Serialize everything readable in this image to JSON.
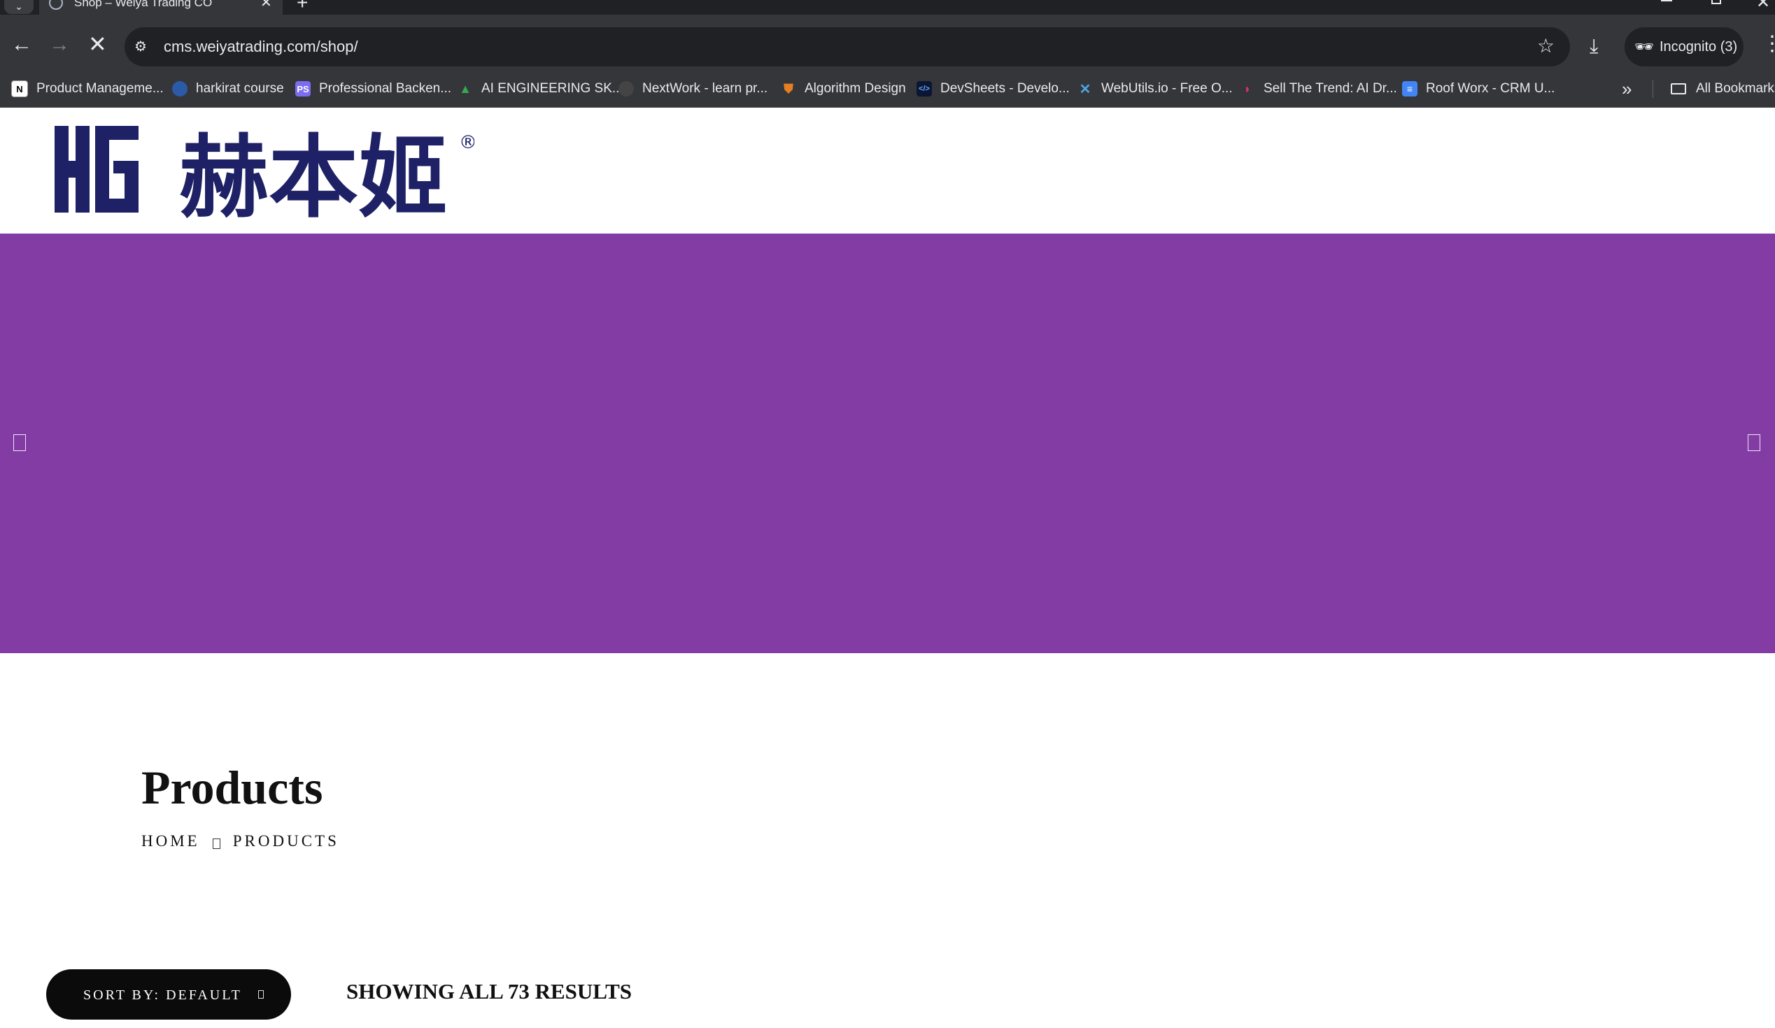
{
  "browser": {
    "tab": {
      "title": "Shop – Weiya Trading CO",
      "close_glyph": "✕"
    },
    "new_tab_glyph": "+",
    "url": "cms.weiyatrading.com/shop/",
    "incognito_label": "Incognito (3)",
    "bookmarks": [
      {
        "label": "Product Manageme...",
        "icon": "notion-icon",
        "color": "#ffffff"
      },
      {
        "label": "harkirat course",
        "icon": "avatar-icon",
        "color": "#2b5aa8"
      },
      {
        "label": "Professional Backen...",
        "icon": "ps-icon",
        "color": "#7b6cf0"
      },
      {
        "label": "AI ENGINEERING SK...",
        "icon": "drive-icon",
        "color": "#34a853"
      },
      {
        "label": "NextWork - learn pr...",
        "icon": "nextwork-icon",
        "color": "#444444"
      },
      {
        "label": "Algorithm Design",
        "icon": "shield-icon",
        "color": "#c0392b"
      },
      {
        "label": "DevSheets - Develo...",
        "icon": "code-icon",
        "color": "#1a73e8"
      },
      {
        "label": "WebUtils.io - Free O...",
        "icon": "tools-icon",
        "color": "#4fa3e0"
      },
      {
        "label": "Sell The Trend: AI Dr...",
        "icon": "sellthetrend-icon",
        "color": "#d6336c"
      },
      {
        "label": "Roof Worx - CRM U...",
        "icon": "docs-icon",
        "color": "#4285f4"
      }
    ],
    "all_bookmarks_label": "All Bookmarks"
  },
  "header": {
    "logo_text": "赫本姬",
    "logo_mark": "HG",
    "logo_registered": "®",
    "brand_color": "#1e2166"
  },
  "hero": {
    "background": "#833ca4"
  },
  "main": {
    "title": "Products",
    "breadcrumb": [
      "HOME",
      "PRODUCTS"
    ],
    "sort_label": "SORT BY: DEFAULT",
    "results_text": "SHOWING ALL 73 RESULTS"
  }
}
